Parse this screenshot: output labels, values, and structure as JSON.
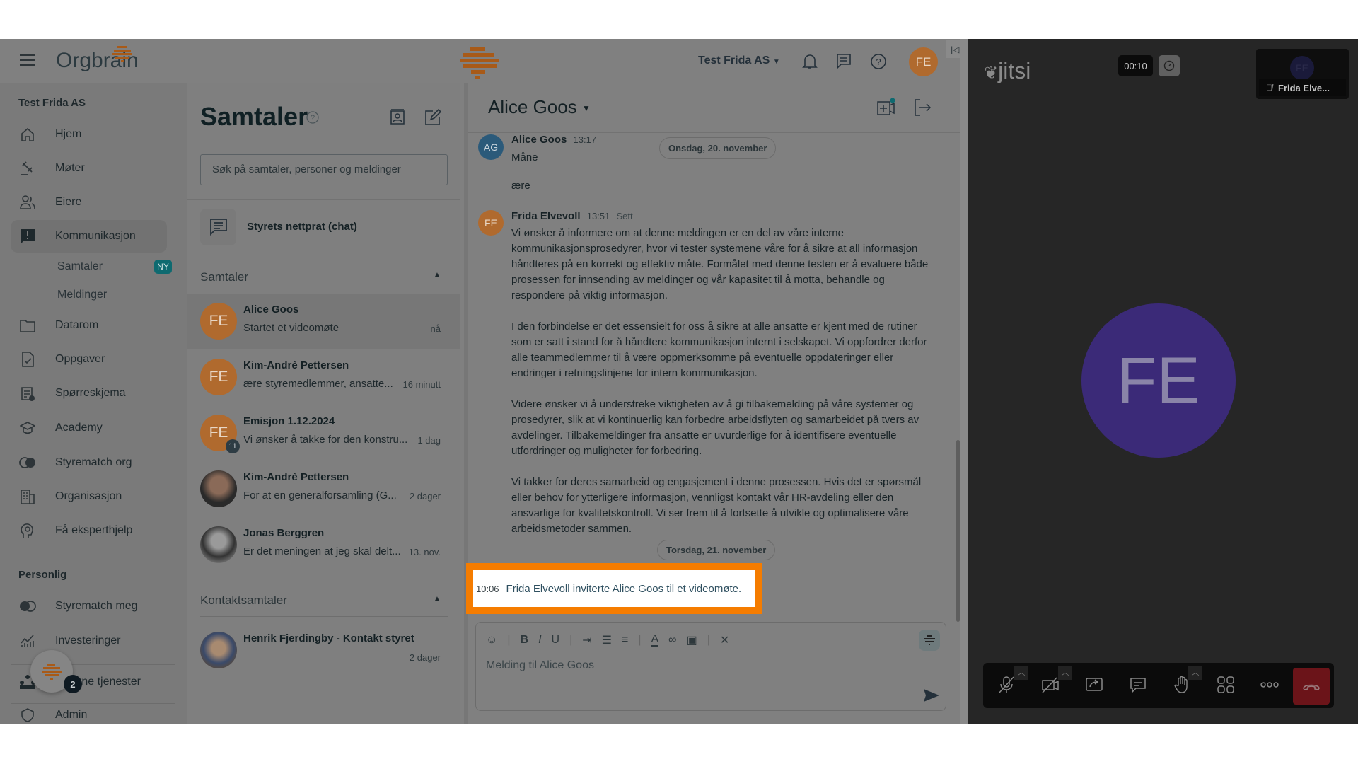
{
  "header": {
    "brand": "Orgbrain",
    "org_selector": "Test Frida AS",
    "user_initials": "FE"
  },
  "sidebar": {
    "org": "Test Frida AS",
    "items": [
      {
        "label": "Hjem",
        "icon": "home-icon"
      },
      {
        "label": "Møter",
        "icon": "gavel-icon"
      },
      {
        "label": "Eiere",
        "icon": "people-icon"
      },
      {
        "label": "Kommunikasjon",
        "icon": "alert-message-icon"
      },
      {
        "label": "Datarom",
        "icon": "folder-icon"
      },
      {
        "label": "Oppgaver",
        "icon": "task-icon"
      },
      {
        "label": "Spørreskjema",
        "icon": "survey-icon"
      },
      {
        "label": "Academy",
        "icon": "graduation-icon"
      },
      {
        "label": "Styrematch org",
        "icon": "match-icon"
      },
      {
        "label": "Organisasjon",
        "icon": "building-icon"
      },
      {
        "label": "Få eksperthjelp",
        "icon": "expert-icon"
      }
    ],
    "subitems": [
      {
        "label": "Samtaler",
        "badge": "NY"
      },
      {
        "label": "Meldinger"
      }
    ],
    "personal_title": "Personlig",
    "personal_items": [
      {
        "label": "Styrematch meg"
      },
      {
        "label": "Investeringer"
      }
    ],
    "external": "rne tjenester",
    "admin": "Admin",
    "fab_badge": "2"
  },
  "list": {
    "title": "Samtaler",
    "search_placeholder": "Søk på samtaler, personer og meldinger",
    "board_chat": "Styrets nettprat (chat)",
    "section_conversations": "Samtaler",
    "conversations": [
      {
        "initials": "FE",
        "name": "Alice Goos",
        "preview": "Startet et videomøte",
        "time": "nå"
      },
      {
        "initials": "FE",
        "name": "Kim-Andrè Pettersen",
        "preview": "ære styremedlemmer, ansatte...",
        "time": "16 minutt"
      },
      {
        "initials": "FE",
        "name": "Emisjon 1.12.2024",
        "preview": "Vi ønsker å takke for den konstru...",
        "time": "1 dag",
        "badge": "11"
      },
      {
        "initials": "",
        "name": "Kim-Andrè Pettersen",
        "preview": "For at en generalforsamling (G...",
        "time": "2 dager"
      },
      {
        "initials": "",
        "name": "Jonas Berggren",
        "preview": "Er det meningen at jeg skal delt...",
        "time": "13. nov."
      }
    ],
    "section_contacts": "Kontaktsamtaler",
    "contacts": [
      {
        "name": "Henrik Fjerdingby - Kontakt styret",
        "time": "2 dager"
      }
    ]
  },
  "chat": {
    "title": "Alice Goos",
    "messages": [
      {
        "initials": "AG",
        "author": "Alice Goos",
        "time": "13:17",
        "lines": [
          "Måne",
          "ære"
        ]
      },
      {
        "initials": "FE",
        "author": "Frida Elvevoll",
        "time": "13:51",
        "status": "Sett",
        "paragraphs": [
          "Vi ønsker å informere om at denne meldingen er en del av våre interne kommunikasjonsprosedyrer, hvor vi tester systemene våre for å sikre at all informasjon håndteres på en korrekt og effektiv måte. Formålet med denne testen er å evaluere både prosessen for innsending av meldinger og vår kapasitet til å motta, behandle og respondere på viktig informasjon.",
          "I den forbindelse er det essensielt for oss å sikre at alle ansatte er kjent med de rutiner som er satt i stand for å håndtere kommunikasjon internt i selskapet. Vi oppfordrer derfor alle teammedlemmer til å være oppmerksomme på eventuelle oppdateringer eller endringer i retningslinjene for intern kommunikasjon.",
          "Videre ønsker vi å understreke viktigheten av å gi tilbakemelding på våre systemer og prosedyrer, slik at vi kontinuerlig kan forbedre arbeidsflyten og samarbeidet på tvers av avdelinger. Tilbakemeldinger fra ansatte er uvurderlige for å identifisere eventuelle utfordringer og muligheter for forbedring.",
          "Vi takker for deres samarbeid og engasjement i denne prosessen. Hvis det er spørsmål eller behov for ytterligere informasjon, vennligst kontakt vår HR-avdeling eller den ansvarlige for kvalitetskontroll. Vi ser frem til å fortsette å utvikle og optimalisere våre arbeidsmetoder sammen."
        ]
      }
    ],
    "date_1": "Onsdag, 20. november",
    "date_2": "Torsdag, 21. november",
    "system_message": {
      "time": "10:06",
      "text": "Frida Elvevoll inviterte Alice Goos til et videomøte."
    },
    "composer_placeholder": "Melding til Alice Goos"
  },
  "jitsi": {
    "logo": "jitsi",
    "timer": "00:10",
    "thumbnail_name": "Frida Elve...",
    "avatar_initials": "FE",
    "thumb_initials": "FE"
  },
  "colors": {
    "highlight": "#f57c00",
    "brand_orange": "#b06a2e",
    "badge_teal": "#0e6a70",
    "hangup": "#6b1419"
  }
}
